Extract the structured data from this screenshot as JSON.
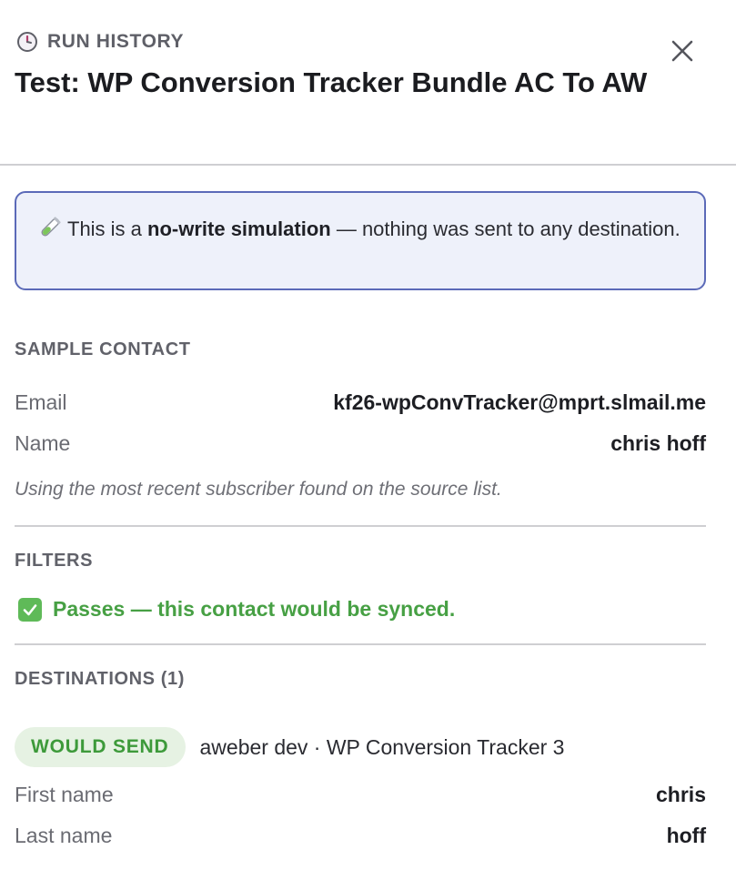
{
  "header": {
    "eyebrow": "RUN HISTORY",
    "title": "Test: WP Conversion Tracker Bundle AC To AW",
    "icons": {
      "eyebrow": "clock-icon",
      "close": "close-icon"
    }
  },
  "notice": {
    "icon": "test-tube-icon",
    "prefix": "This is a ",
    "emphasis": "no-write simulation",
    "suffix": " — nothing was sent to any destination."
  },
  "sample_contact": {
    "label": "SAMPLE CONTACT",
    "rows": [
      {
        "key": "Email",
        "value": "kf26-wpConvTracker@mprt.slmail.me"
      },
      {
        "key": "Name",
        "value": "chris hoff"
      }
    ],
    "note": "Using the most recent subscriber found on the source list."
  },
  "filters": {
    "label": "FILTERS",
    "icon": "check-icon",
    "result": "Passes — this contact would be synced."
  },
  "destinations": {
    "label": "DESTINATIONS (1)",
    "badge": "WOULD SEND",
    "target": "aweber dev · WP Conversion Tracker 3",
    "fields": [
      {
        "key": "First name",
        "value": "chris"
      },
      {
        "key": "Last name",
        "value": "hoff"
      }
    ]
  },
  "colors": {
    "accent_border": "#5b6ab8",
    "notice_bg": "#eef1fa",
    "success": "#47a044",
    "badge_bg": "#e6f2e3"
  }
}
